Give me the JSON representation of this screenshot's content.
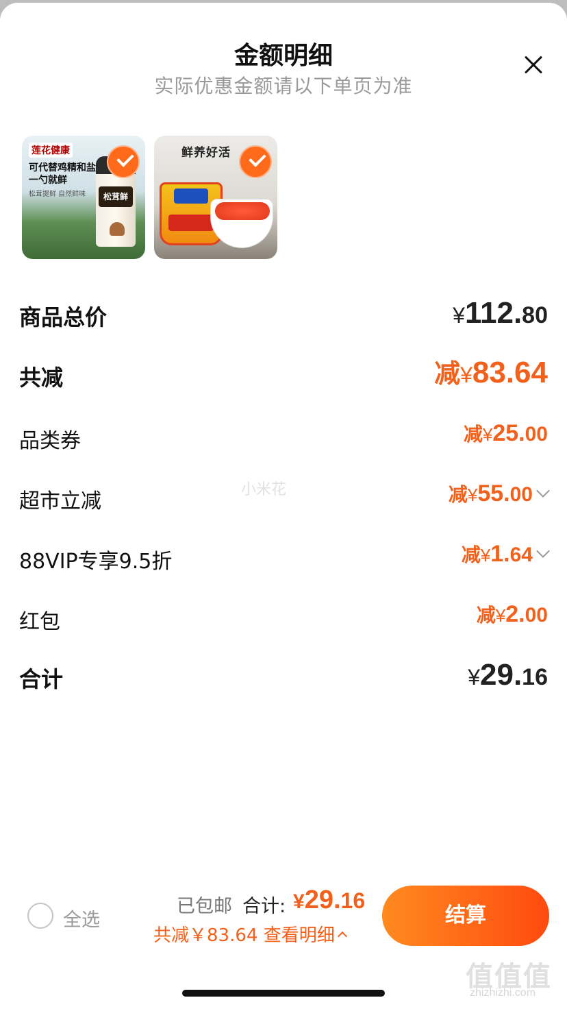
{
  "header": {
    "title": "金额明细",
    "subtitle": "实际优惠金额请以下单页为准"
  },
  "products": [
    {
      "brand": "莲花健康",
      "line1": "可代替鸡精和盐",
      "line2": "一勺就鲜",
      "line3": "松茸提鲜 自然鲜味",
      "label": "松茸鲜",
      "selected": true
    },
    {
      "title": "鲜养好活",
      "selected": true
    }
  ],
  "breakdown": {
    "subtotal": {
      "label": "商品总价",
      "prefix": "",
      "currency": "¥",
      "int": "112.",
      "dec": "80"
    },
    "total_discount": {
      "label": "共减",
      "prefix": "减",
      "currency": "¥",
      "int": "83.",
      "dec": "64"
    },
    "items": [
      {
        "label": "品类券",
        "prefix": "减",
        "currency": "¥",
        "int": "25.",
        "dec": "00",
        "expandable": false
      },
      {
        "label": "超市立减",
        "prefix": "减",
        "currency": "¥",
        "int": "55.",
        "dec": "00",
        "expandable": true
      },
      {
        "label": "88VIP专享9.5折",
        "prefix": "减",
        "currency": "¥",
        "int": "1.",
        "dec": "64",
        "expandable": true
      },
      {
        "label": "红包",
        "prefix": "减",
        "currency": "¥",
        "int": "2.",
        "dec": "00",
        "expandable": false
      }
    ],
    "total": {
      "label": "合计",
      "currency": "¥",
      "int": "29.",
      "dec": "16"
    }
  },
  "watermark": "小米花",
  "footer": {
    "select_all": "全选",
    "free_shipping": "已包邮",
    "total_label": "合计:",
    "total_currency": "¥",
    "total_int": "29.",
    "total_dec": "16",
    "saved_text": "共减￥83.64",
    "detail_link": "查看明细",
    "checkout": "结算"
  },
  "site": {
    "logo": "值值值",
    "url": "zhizhizhi.com"
  },
  "colors": {
    "accent": "#f2611b",
    "checkout_from": "#ff8a1f",
    "checkout_to": "#ff4a0f"
  }
}
